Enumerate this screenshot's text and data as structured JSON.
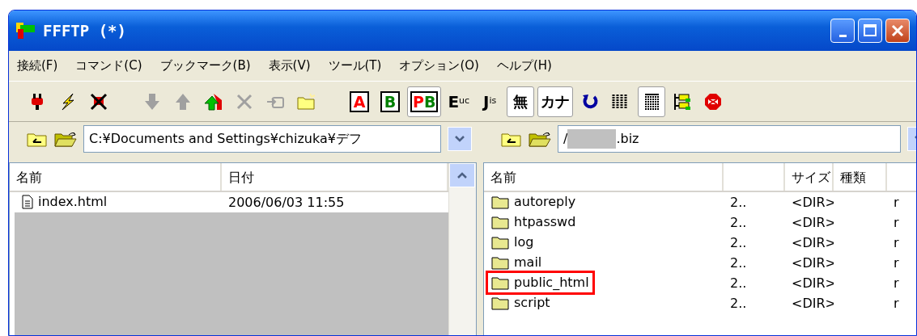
{
  "window": {
    "title": "FFFTP (*)"
  },
  "menu": [
    "接続(F)",
    "コマンド(C)",
    "ブックマーク(B)",
    "表示(V)",
    "ツール(T)",
    "オプション(O)",
    "ヘルプ(H)"
  ],
  "toolbar": [
    {
      "kind": "icon",
      "disabled": false,
      "selected": false
    },
    {
      "kind": "icon",
      "disabled": false,
      "selected": false
    },
    {
      "kind": "icon",
      "disabled": false,
      "selected": false
    },
    {
      "kind": "gap"
    },
    {
      "kind": "icon",
      "disabled": true,
      "selected": false
    },
    {
      "kind": "icon",
      "disabled": true,
      "selected": false
    },
    {
      "kind": "icon",
      "disabled": false,
      "selected": false
    },
    {
      "kind": "icon",
      "disabled": true,
      "selected": false
    },
    {
      "kind": "icon",
      "disabled": true,
      "selected": false
    },
    {
      "kind": "icon",
      "disabled": false,
      "selected": false
    },
    {
      "kind": "gap"
    },
    {
      "kind": "letter",
      "text": "A",
      "color": "#ff0000",
      "selected": false
    },
    {
      "kind": "letter",
      "text": "B",
      "color": "#008000",
      "selected": false
    },
    {
      "kind": "pair",
      "texts": [
        "P",
        "B"
      ],
      "selected": true
    },
    {
      "kind": "code",
      "main": "E",
      "sub": "uc",
      "selected": false
    },
    {
      "kind": "code",
      "main": "J",
      "sub": "is",
      "selected": false
    },
    {
      "kind": "word",
      "text": "無",
      "selected": true
    },
    {
      "kind": "word",
      "text": "カナ",
      "selected": true
    },
    {
      "kind": "icon",
      "disabled": false,
      "selected": false
    },
    {
      "kind": "icon",
      "disabled": false,
      "selected": false
    },
    {
      "kind": "icon",
      "disabled": false,
      "selected": true
    },
    {
      "kind": "icon",
      "disabled": false,
      "selected": false
    },
    {
      "kind": "icon",
      "disabled": false,
      "selected": false
    }
  ],
  "local": {
    "path": "C:¥Documents and Settings¥chizuka¥デフ",
    "columns": [
      "名前",
      "日付"
    ],
    "rows": [
      {
        "name": "index.html",
        "date": "2006/06/03 11:55"
      }
    ]
  },
  "remote": {
    "path_start": "/",
    "path_end": ".biz",
    "redacted": true,
    "columns": [
      "名前",
      "",
      "サイズ",
      "種類"
    ],
    "rows": [
      {
        "name": "autoreply",
        "date": "2..",
        "size": "<DIR>",
        "attr": "r",
        "highlighted": false
      },
      {
        "name": "htpasswd",
        "date": "2..",
        "size": "<DIR>",
        "attr": "r",
        "highlighted": false
      },
      {
        "name": "log",
        "date": "2..",
        "size": "<DIR>",
        "attr": "r",
        "highlighted": false
      },
      {
        "name": "mail",
        "date": "2..",
        "size": "<DIR>",
        "attr": "r",
        "highlighted": false
      },
      {
        "name": "public_html",
        "date": "2..",
        "size": "<DIR>",
        "attr": "r",
        "highlighted": true
      },
      {
        "name": "script",
        "date": "2..",
        "size": "<DIR>",
        "attr": "r",
        "highlighted": false
      }
    ]
  }
}
